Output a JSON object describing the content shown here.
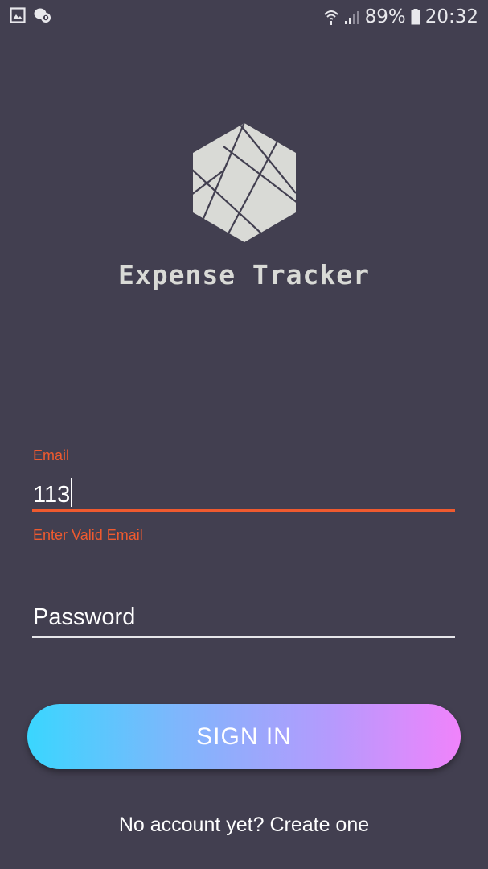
{
  "status_bar": {
    "left_icons": [
      "image-icon",
      "chat-bubble-icon"
    ],
    "right_icons": [
      "wifi-icon",
      "signal-icon",
      "battery-icon"
    ],
    "battery_percent": "89%",
    "time": "20:32"
  },
  "app": {
    "title": "Expense Tracker",
    "logo_icon": "hexagon-logo-icon"
  },
  "form": {
    "email": {
      "label": "Email",
      "value": "113",
      "error": "Enter Valid Email"
    },
    "password": {
      "placeholder": "Password",
      "value": ""
    },
    "signin_label": "SIGN IN",
    "create_account_text": "No account yet? Create one"
  },
  "colors": {
    "background": "#423f50",
    "error": "#ef5a2f",
    "logo_fill": "#d9dad6",
    "button_gradient_start": "#3ad6fe",
    "button_gradient_end": "#f083fb"
  }
}
